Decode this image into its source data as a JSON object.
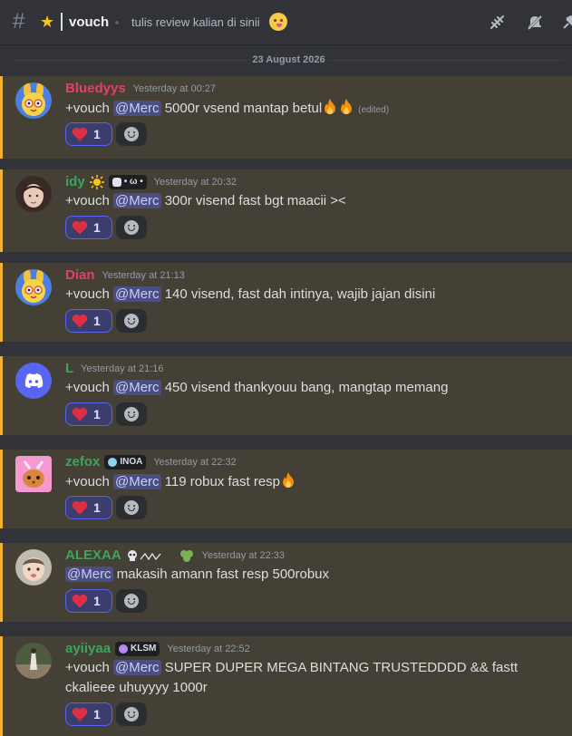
{
  "header": {
    "hash_icon": "hash-icon",
    "channel_emoji": "star",
    "channel_name": "vouch",
    "topic": "tulis review kalian di sinii",
    "topic_emoji": "yum-face",
    "icons": [
      "threads-icon",
      "mute-icon",
      "pin-icon"
    ]
  },
  "date_divider": "23 August 2026",
  "colors": {
    "highlight_bg": "#444036",
    "highlight_border": "#f0b232",
    "mention_bg": "#4b4e80",
    "reaction_border": "#5865f2"
  },
  "messages": [
    {
      "username": "Bluedyys",
      "username_color": "#e53e6c",
      "timestamp": "Yesterday at 00:27",
      "prefix": "+vouch",
      "mention": "@Merc",
      "text": "5000r vsend mantap betul",
      "edited": "(edited)",
      "reaction_emoji": "heart",
      "reaction_count": "1"
    },
    {
      "username": "idy",
      "username_color": "#3ba55c",
      "badge_tag": "• ω •",
      "timestamp": "Yesterday at 20:32",
      "prefix": "+vouch",
      "mention": "@Merc",
      "text": "300r visend fast bgt maacii ><",
      "reaction_emoji": "heart",
      "reaction_count": "1"
    },
    {
      "username": "Dian",
      "username_color": "#e53e6c",
      "timestamp": "Yesterday at 21:13",
      "prefix": "+vouch",
      "mention": "@Merc",
      "text": "140 visend, fast dah intinya, wajib jajan disini",
      "reaction_emoji": "heart",
      "reaction_count": "1"
    },
    {
      "username": "L",
      "username_color": "#3ba55c",
      "timestamp": "Yesterday at 21:16",
      "prefix": "+vouch",
      "mention": "@Merc",
      "text": "450 visend thankyouu bang, mangtap memang",
      "reaction_emoji": "heart",
      "reaction_count": "1"
    },
    {
      "username": "zefox",
      "username_color": "#3ba55c",
      "badge_tag": "INOA",
      "timestamp": "Yesterday at 22:32",
      "prefix": "+vouch",
      "mention": "@Merc",
      "text": "119 robux fast resp",
      "reaction_emoji": "heart",
      "reaction_count": "1"
    },
    {
      "username": "ALEXAA",
      "username_color": "#3ba55c",
      "timestamp": "Yesterday at 22:33",
      "mention": "@Merc",
      "text": "makasih amann fast resp 500robux",
      "reaction_emoji": "heart",
      "reaction_count": "1"
    },
    {
      "username": "ayiiyaa",
      "username_color": "#3ba55c",
      "badge_tag": "KLSM",
      "timestamp": "Yesterday at 22:52",
      "prefix": "+vouch",
      "mention": "@Merc",
      "text": "SUPER DUPER MEGA BINTANG TRUSTEDDDD && fastt ckalieee uhuyyyy 1000r",
      "reaction_emoji": "heart",
      "reaction_count": "1"
    }
  ]
}
